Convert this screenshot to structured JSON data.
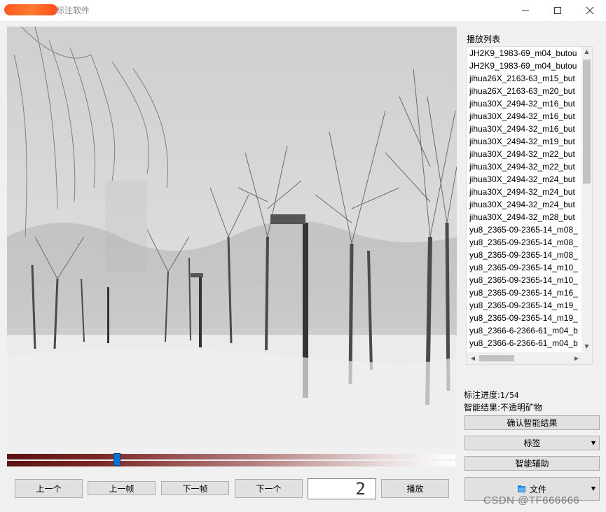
{
  "window": {
    "title": "标注软件",
    "controls": [
      "minimize-icon",
      "maximize-icon",
      "close-icon"
    ]
  },
  "playlist": {
    "title": "播放列表",
    "items": [
      "JH2K9_1983-69_m04_butou",
      "JH2K9_1983-69_m04_butou",
      "jihua26X_2163-63_m15_but",
      "jihua26X_2163-63_m20_but",
      "jihua30X_2494-32_m16_but",
      "jihua30X_2494-32_m16_but",
      "jihua30X_2494-32_m16_but",
      "jihua30X_2494-32_m19_but",
      "jihua30X_2494-32_m22_but",
      "jihua30X_2494-32_m22_but",
      "jihua30X_2494-32_m24_but",
      "jihua30X_2494-32_m24_but",
      "jihua30X_2494-32_m24_but",
      "jihua30X_2494-32_m28_but",
      "yu8_2365-09-2365-14_m08_",
      "yu8_2365-09-2365-14_m08_",
      "yu8_2365-09-2365-14_m08_",
      "yu8_2365-09-2365-14_m10_",
      "yu8_2365-09-2365-14_m10_",
      "yu8_2365-09-2365-14_m16_",
      "yu8_2365-09-2365-14_m19_",
      "yu8_2365-09-2365-14_m19_",
      "yu8_2366-6-2366-61_m04_b",
      "yu8_2366-6-2366-61_m04_b"
    ]
  },
  "status": {
    "progress_label": "标注进度:",
    "progress_value": "1/54",
    "result_label": "智能结果:",
    "result_value": "不透明矿物"
  },
  "side_buttons": {
    "confirm": "确认智能结果",
    "tag": "标签",
    "assist": "智能辅助",
    "file": "文件"
  },
  "controls": {
    "prev_item": "上一个",
    "prev_frame": "上一帧",
    "next_frame": "下一帧",
    "next_item": "下一个",
    "frame_number": "2",
    "play": "播放"
  },
  "timeline": {
    "position_fraction": 0.245
  },
  "watermark": "CSDN @TF666666"
}
